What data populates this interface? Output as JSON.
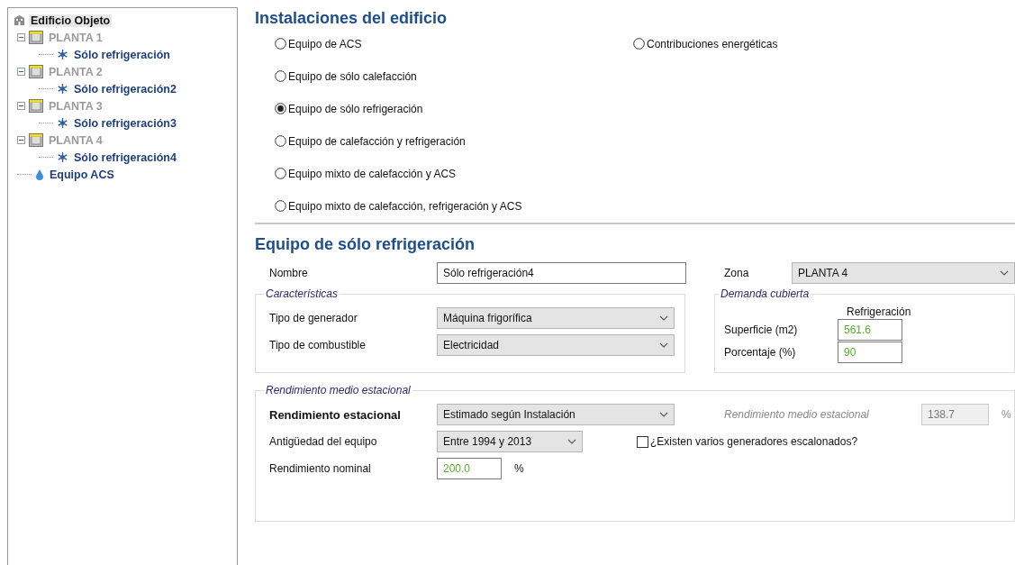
{
  "tree": [
    {
      "kind": "building",
      "label": "Edificio Objeto",
      "selected": true,
      "children": [
        {
          "kind": "floor",
          "label": "PLANTA 1",
          "expanded": true,
          "children": [
            {
              "kind": "cooling",
              "label": "Sólo refrigeración"
            }
          ]
        },
        {
          "kind": "floor",
          "label": "PLANTA 2",
          "expanded": true,
          "children": [
            {
              "kind": "cooling",
              "label": "Sólo refrigeración2"
            }
          ]
        },
        {
          "kind": "floor",
          "label": "PLANTA 3",
          "expanded": true,
          "children": [
            {
              "kind": "cooling",
              "label": "Sólo refrigeración3"
            }
          ]
        },
        {
          "kind": "floor",
          "label": "PLANTA 4",
          "expanded": true,
          "children": [
            {
              "kind": "cooling",
              "label": "Sólo refrigeración4"
            }
          ]
        },
        {
          "kind": "water",
          "label": "Equipo ACS"
        }
      ]
    }
  ],
  "installations": {
    "title": "Instalaciones del edificio",
    "column_1": [
      {
        "label": "Equipo de ACS",
        "selected": false
      },
      {
        "label": "Equipo de sólo calefacción",
        "selected": false
      },
      {
        "label": "Equipo de sólo refrigeración",
        "selected": true
      },
      {
        "label": "Equipo de calefacción y refrigeración",
        "selected": false
      },
      {
        "label": "Equipo mixto de calefacción y ACS",
        "selected": false
      },
      {
        "label": "Equipo mixto de calefacción, refrigeración y ACS",
        "selected": false
      }
    ],
    "column_2": [
      {
        "label": "Contribuciones energéticas",
        "selected": false
      }
    ]
  },
  "equipment": {
    "title": "Equipo de sólo refrigeración",
    "name": {
      "label": "Nombre",
      "value": "Sólo refrigeración4"
    },
    "zone": {
      "label": "Zona",
      "value": "PLANTA 4"
    },
    "characteristics": {
      "legend": "Características",
      "rows": [
        {
          "label": "Tipo de generador",
          "value": "Máquina frigorífica"
        },
        {
          "label": "Tipo de combustible",
          "value": "Electricidad"
        }
      ]
    },
    "demand": {
      "legend": "Demanda cubierta",
      "column": "Refrigeración",
      "rows": [
        {
          "label": "Superficie (m2)",
          "value": "561.6"
        },
        {
          "label": "Porcentaje (%)",
          "value": "90"
        }
      ]
    },
    "performance": {
      "legend": "Rendimiento medio estacional",
      "seasonal": {
        "label": "Rendimiento estacional",
        "value": "Estimado según Instalación"
      },
      "average": {
        "label": "Rendimiento medio estacional",
        "value": "138.7",
        "unit": "%",
        "disabled": true
      },
      "age": {
        "label": "Antigüedad del equipo",
        "value": "Entre 1994 y 2013"
      },
      "staggered": {
        "label": "¿Existen varios generadores escalonados?",
        "checked": false
      },
      "nominal": {
        "label": "Rendimiento nominal",
        "value": "200.0",
        "unit": "%"
      }
    }
  }
}
